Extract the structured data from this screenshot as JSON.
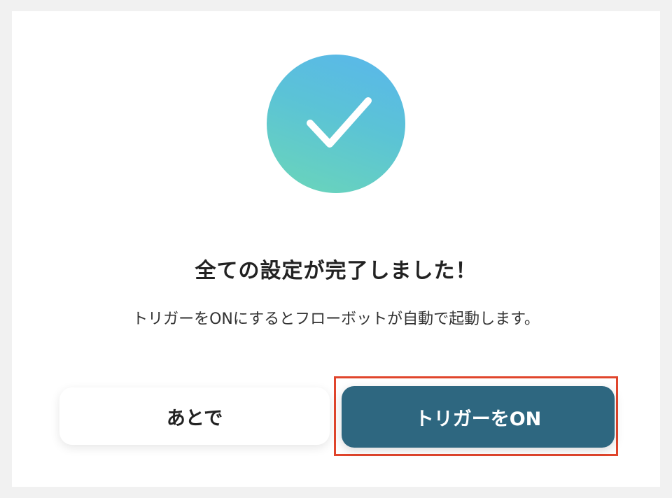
{
  "dialog": {
    "title": "全ての設定が完了しました！",
    "message": "トリガーをONにするとフローボットが自動で起動します。",
    "success_icon": "check-icon"
  },
  "buttons": {
    "later_label": "あとで",
    "trigger_on_label": "トリガーをON"
  },
  "colors": {
    "primary": "#2e6780",
    "badge_gradient_start": "#5ab6ec",
    "badge_gradient_end": "#6bd6b8",
    "highlight": "#e0452c"
  }
}
